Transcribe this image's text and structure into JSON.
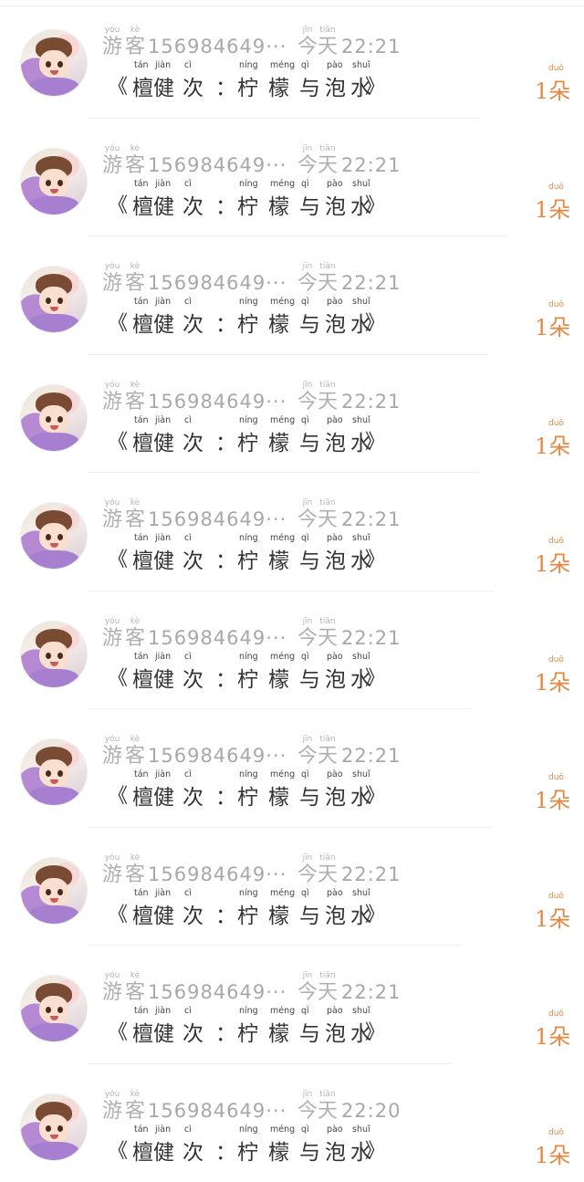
{
  "rows": [
    {
      "user": "156984649···",
      "user_py": [
        "yóu",
        "kè"
      ],
      "user_hz": [
        "游",
        "客"
      ],
      "time_py": [
        "jīn",
        "tiān"
      ],
      "time_hz": [
        "今",
        "天"
      ],
      "time": "22:21",
      "count": "1朵",
      "count_py": "duǒ"
    },
    {
      "user": "156984649···",
      "user_py": [
        "yóu",
        "kè"
      ],
      "user_hz": [
        "游",
        "客"
      ],
      "time_py": [
        "jīn",
        "tiān"
      ],
      "time_hz": [
        "今",
        "天"
      ],
      "time": "22:21",
      "count": "1朵",
      "count_py": "duǒ"
    },
    {
      "user": "156984649···",
      "user_py": [
        "yóu",
        "kè"
      ],
      "user_hz": [
        "游",
        "客"
      ],
      "time_py": [
        "jīn",
        "tiān"
      ],
      "time_hz": [
        "今",
        "天"
      ],
      "time": "22:21",
      "count": "1朵",
      "count_py": "duǒ"
    },
    {
      "user": "156984649···",
      "user_py": [
        "yóu",
        "kè"
      ],
      "user_hz": [
        "游",
        "客"
      ],
      "time_py": [
        "jīn",
        "tiān"
      ],
      "time_hz": [
        "今",
        "天"
      ],
      "time": "22:21",
      "count": "1朵",
      "count_py": "duǒ"
    },
    {
      "user": "156984649···",
      "user_py": [
        "yóu",
        "kè"
      ],
      "user_hz": [
        "游",
        "客"
      ],
      "time_py": [
        "jīn",
        "tiān"
      ],
      "time_hz": [
        "今",
        "天"
      ],
      "time": "22:21",
      "count": "1朵",
      "count_py": "duǒ"
    },
    {
      "user": "156984649···",
      "user_py": [
        "yóu",
        "kè"
      ],
      "user_hz": [
        "游",
        "客"
      ],
      "time_py": [
        "jīn",
        "tiān"
      ],
      "time_hz": [
        "今",
        "天"
      ],
      "time": "22:21",
      "count": "1朵",
      "count_py": "duǒ"
    },
    {
      "user": "156984649···",
      "user_py": [
        "yóu",
        "kè"
      ],
      "user_hz": [
        "游",
        "客"
      ],
      "time_py": [
        "jīn",
        "tiān"
      ],
      "time_hz": [
        "今",
        "天"
      ],
      "time": "22:21",
      "count": "1朵",
      "count_py": "duǒ"
    },
    {
      "user": "156984649···",
      "user_py": [
        "yóu",
        "kè"
      ],
      "user_hz": [
        "游",
        "客"
      ],
      "time_py": [
        "jīn",
        "tiān"
      ],
      "time_hz": [
        "今",
        "天"
      ],
      "time": "22:21",
      "count": "1朵",
      "count_py": "duǒ"
    },
    {
      "user": "156984649···",
      "user_py": [
        "yóu",
        "kè"
      ],
      "user_hz": [
        "游",
        "客"
      ],
      "time_py": [
        "jīn",
        "tiān"
      ],
      "time_hz": [
        "今",
        "天"
      ],
      "time": "22:21",
      "count": "1朵",
      "count_py": "duǒ"
    },
    {
      "user": "156984649···",
      "user_py": [
        "yóu",
        "kè"
      ],
      "user_hz": [
        "游",
        "客"
      ],
      "time_py": [
        "jīn",
        "tiān"
      ],
      "time_hz": [
        "今",
        "天"
      ],
      "time": "22:20",
      "count": "1朵",
      "count_py": "duǒ"
    }
  ],
  "title": {
    "open_quote": "《",
    "close_quote": "》",
    "chars": [
      "檀",
      "健",
      "次",
      "：",
      "柠",
      "檬",
      "与",
      "泡",
      "水"
    ],
    "pinyin": [
      "tán",
      "jiàn",
      "cì",
      "",
      "níng",
      "méng",
      "qì",
      "pào",
      "shuǐ"
    ]
  },
  "colors": {
    "accent": "#e08a45",
    "muted": "#a8a8a8",
    "text": "#333333"
  }
}
